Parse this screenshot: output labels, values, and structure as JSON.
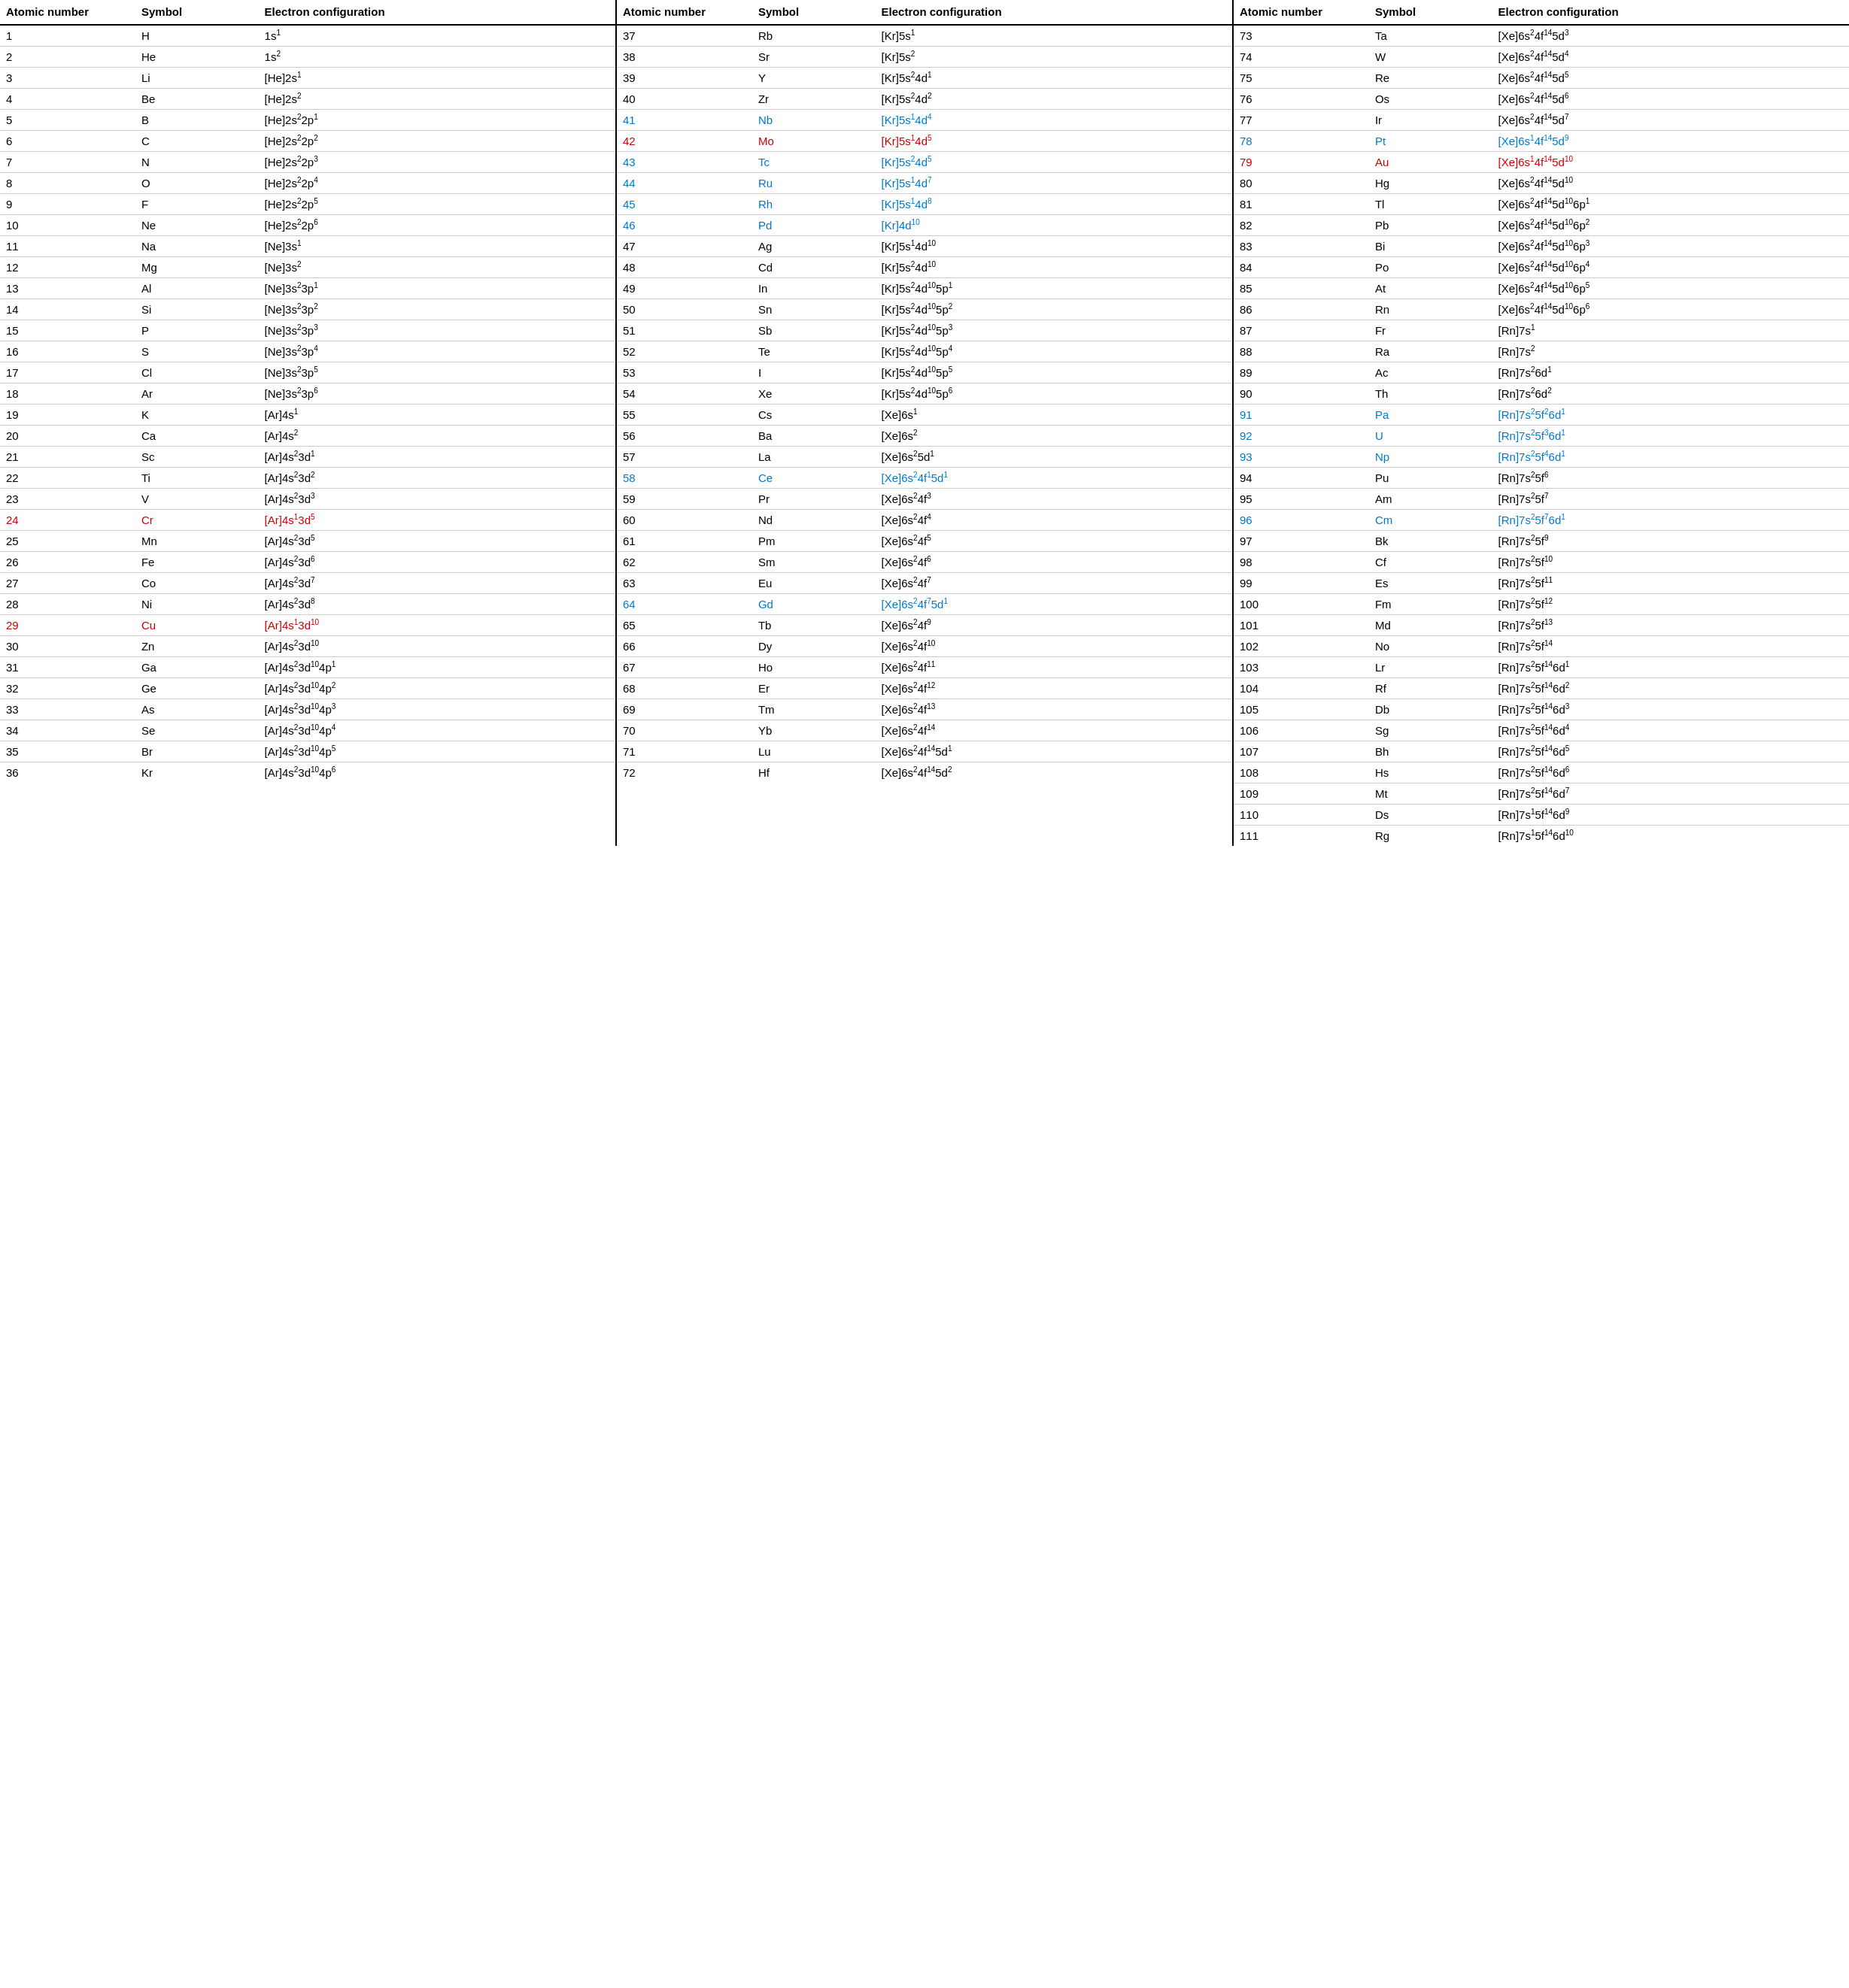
{
  "headers": {
    "atomic_number": "Atomic number",
    "symbol": "Symbol",
    "electron_config": "Electron configuration"
  },
  "sections": [
    {
      "id": "section1",
      "rows": [
        {
          "num": "1",
          "sym": "H",
          "conf": "1s<sup>1</sup>",
          "color": ""
        },
        {
          "num": "2",
          "sym": "He",
          "conf": "1s<sup>2</sup>",
          "color": ""
        },
        {
          "num": "3",
          "sym": "Li",
          "conf": "[He]2s<sup>1</sup>",
          "color": ""
        },
        {
          "num": "4",
          "sym": "Be",
          "conf": "[He]2s<sup>2</sup>",
          "color": ""
        },
        {
          "num": "5",
          "sym": "B",
          "conf": "[He]2s<sup>2</sup>2p<sup>1</sup>",
          "color": ""
        },
        {
          "num": "6",
          "sym": "C",
          "conf": "[He]2s<sup>2</sup>2p<sup>2</sup>",
          "color": ""
        },
        {
          "num": "7",
          "sym": "N",
          "conf": "[He]2s<sup>2</sup>2p<sup>3</sup>",
          "color": ""
        },
        {
          "num": "8",
          "sym": "O",
          "conf": "[He]2s<sup>2</sup>2p<sup>4</sup>",
          "color": ""
        },
        {
          "num": "9",
          "sym": "F",
          "conf": "[He]2s<sup>2</sup>2p<sup>5</sup>",
          "color": ""
        },
        {
          "num": "10",
          "sym": "Ne",
          "conf": "[He]2s<sup>2</sup>2p<sup>6</sup>",
          "color": ""
        },
        {
          "num": "11",
          "sym": "Na",
          "conf": "[Ne]3s<sup>1</sup>",
          "color": ""
        },
        {
          "num": "12",
          "sym": "Mg",
          "conf": "[Ne]3s<sup>2</sup>",
          "color": ""
        },
        {
          "num": "13",
          "sym": "Al",
          "conf": "[Ne]3s<sup>2</sup>3p<sup>1</sup>",
          "color": ""
        },
        {
          "num": "14",
          "sym": "Si",
          "conf": "[Ne]3s<sup>2</sup>3p<sup>2</sup>",
          "color": ""
        },
        {
          "num": "15",
          "sym": "P",
          "conf": "[Ne]3s<sup>2</sup>3p<sup>3</sup>",
          "color": ""
        },
        {
          "num": "16",
          "sym": "S",
          "conf": "[Ne]3s<sup>2</sup>3p<sup>4</sup>",
          "color": ""
        },
        {
          "num": "17",
          "sym": "Cl",
          "conf": "[Ne]3s<sup>2</sup>3p<sup>5</sup>",
          "color": ""
        },
        {
          "num": "18",
          "sym": "Ar",
          "conf": "[Ne]3s<sup>2</sup>3p<sup>6</sup>",
          "color": ""
        },
        {
          "num": "19",
          "sym": "K",
          "conf": "[Ar]4s<sup>1</sup>",
          "color": ""
        },
        {
          "num": "20",
          "sym": "Ca",
          "conf": "[Ar]4s<sup>2</sup>",
          "color": ""
        },
        {
          "num": "21",
          "sym": "Sc",
          "conf": "[Ar]4s<sup>2</sup>3d<sup>1</sup>",
          "color": ""
        },
        {
          "num": "22",
          "sym": "Ti",
          "conf": "[Ar]4s<sup>2</sup>3d<sup>2</sup>",
          "color": ""
        },
        {
          "num": "23",
          "sym": "V",
          "conf": "[Ar]4s<sup>2</sup>3d<sup>3</sup>",
          "color": ""
        },
        {
          "num": "24",
          "sym": "Cr",
          "conf": "[Ar]4s<sup>1</sup>3d<sup>5</sup>",
          "color": "red"
        },
        {
          "num": "25",
          "sym": "Mn",
          "conf": "[Ar]4s<sup>2</sup>3d<sup>5</sup>",
          "color": ""
        },
        {
          "num": "26",
          "sym": "Fe",
          "conf": "[Ar]4s<sup>2</sup>3d<sup>6</sup>",
          "color": ""
        },
        {
          "num": "27",
          "sym": "Co",
          "conf": "[Ar]4s<sup>2</sup>3d<sup>7</sup>",
          "color": ""
        },
        {
          "num": "28",
          "sym": "Ni",
          "conf": "[Ar]4s<sup>2</sup>3d<sup>8</sup>",
          "color": ""
        },
        {
          "num": "29",
          "sym": "Cu",
          "conf": "[Ar]4s<sup>1</sup>3d<sup>10</sup>",
          "color": "red"
        },
        {
          "num": "30",
          "sym": "Zn",
          "conf": "[Ar]4s<sup>2</sup>3d<sup>10</sup>",
          "color": ""
        },
        {
          "num": "31",
          "sym": "Ga",
          "conf": "[Ar]4s<sup>2</sup>3d<sup>10</sup>4p<sup>1</sup>",
          "color": ""
        },
        {
          "num": "32",
          "sym": "Ge",
          "conf": "[Ar]4s<sup>2</sup>3d<sup>10</sup>4p<sup>2</sup>",
          "color": ""
        },
        {
          "num": "33",
          "sym": "As",
          "conf": "[Ar]4s<sup>2</sup>3d<sup>10</sup>4p<sup>3</sup>",
          "color": ""
        },
        {
          "num": "34",
          "sym": "Se",
          "conf": "[Ar]4s<sup>2</sup>3d<sup>10</sup>4p<sup>4</sup>",
          "color": ""
        },
        {
          "num": "35",
          "sym": "Br",
          "conf": "[Ar]4s<sup>2</sup>3d<sup>10</sup>4p<sup>5</sup>",
          "color": ""
        },
        {
          "num": "36",
          "sym": "Kr",
          "conf": "[Ar]4s<sup>2</sup>3d<sup>10</sup>4p<sup>6</sup>",
          "color": ""
        }
      ]
    },
    {
      "id": "section2",
      "rows": [
        {
          "num": "37",
          "sym": "Rb",
          "conf": "[Kr]5s<sup>1</sup>",
          "color": ""
        },
        {
          "num": "38",
          "sym": "Sr",
          "conf": "[Kr]5s<sup>2</sup>",
          "color": ""
        },
        {
          "num": "39",
          "sym": "Y",
          "conf": "[Kr]5s<sup>2</sup>4d<sup>1</sup>",
          "color": ""
        },
        {
          "num": "40",
          "sym": "Zr",
          "conf": "[Kr]5s<sup>2</sup>4d<sup>2</sup>",
          "color": ""
        },
        {
          "num": "41",
          "sym": "Nb",
          "conf": "[Kr]5s<sup>1</sup>4d<sup>4</sup>",
          "color": "blue"
        },
        {
          "num": "42",
          "sym": "Mo",
          "conf": "[Kr]5s<sup>1</sup>4d<sup>5</sup>",
          "color": "red"
        },
        {
          "num": "43",
          "sym": "Tc",
          "conf": "[Kr]5s<sup>2</sup>4d<sup>5</sup>",
          "color": "blue"
        },
        {
          "num": "44",
          "sym": "Ru",
          "conf": "[Kr]5s<sup>1</sup>4d<sup>7</sup>",
          "color": "blue"
        },
        {
          "num": "45",
          "sym": "Rh",
          "conf": "[Kr]5s<sup>1</sup>4d<sup>8</sup>",
          "color": "blue"
        },
        {
          "num": "46",
          "sym": "Pd",
          "conf": "[Kr]4d<sup>10</sup>",
          "color": "blue"
        },
        {
          "num": "47",
          "sym": "Ag",
          "conf": "[Kr]5s<sup>1</sup>4d<sup>10</sup>",
          "color": ""
        },
        {
          "num": "48",
          "sym": "Cd",
          "conf": "[Kr]5s<sup>2</sup>4d<sup>10</sup>",
          "color": ""
        },
        {
          "num": "49",
          "sym": "In",
          "conf": "[Kr]5s<sup>2</sup>4d<sup>10</sup>5p<sup>1</sup>",
          "color": ""
        },
        {
          "num": "50",
          "sym": "Sn",
          "conf": "[Kr]5s<sup>2</sup>4d<sup>10</sup>5p<sup>2</sup>",
          "color": ""
        },
        {
          "num": "51",
          "sym": "Sb",
          "conf": "[Kr]5s<sup>2</sup>4d<sup>10</sup>5p<sup>3</sup>",
          "color": ""
        },
        {
          "num": "52",
          "sym": "Te",
          "conf": "[Kr]5s<sup>2</sup>4d<sup>10</sup>5p<sup>4</sup>",
          "color": ""
        },
        {
          "num": "53",
          "sym": "I",
          "conf": "[Kr]5s<sup>2</sup>4d<sup>10</sup>5p<sup>5</sup>",
          "color": ""
        },
        {
          "num": "54",
          "sym": "Xe",
          "conf": "[Kr]5s<sup>2</sup>4d<sup>10</sup>5p<sup>6</sup>",
          "color": ""
        },
        {
          "num": "55",
          "sym": "Cs",
          "conf": "[Xe]6s<sup>1</sup>",
          "color": ""
        },
        {
          "num": "56",
          "sym": "Ba",
          "conf": "[Xe]6s<sup>2</sup>",
          "color": ""
        },
        {
          "num": "57",
          "sym": "La",
          "conf": "[Xe]6s<sup>2</sup>5d<sup>1</sup>",
          "color": ""
        },
        {
          "num": "58",
          "sym": "Ce",
          "conf": "[Xe]6s<sup>2</sup>4f<sup>1</sup>5d<sup>1</sup>",
          "color": "blue"
        },
        {
          "num": "59",
          "sym": "Pr",
          "conf": "[Xe]6s<sup>2</sup>4f<sup>3</sup>",
          "color": ""
        },
        {
          "num": "60",
          "sym": "Nd",
          "conf": "[Xe]6s<sup>2</sup>4f<sup>4</sup>",
          "color": ""
        },
        {
          "num": "61",
          "sym": "Pm",
          "conf": "[Xe]6s<sup>2</sup>4f<sup>5</sup>",
          "color": ""
        },
        {
          "num": "62",
          "sym": "Sm",
          "conf": "[Xe]6s<sup>2</sup>4f<sup>6</sup>",
          "color": ""
        },
        {
          "num": "63",
          "sym": "Eu",
          "conf": "[Xe]6s<sup>2</sup>4f<sup>7</sup>",
          "color": ""
        },
        {
          "num": "64",
          "sym": "Gd",
          "conf": "[Xe]6s<sup>2</sup>4f<sup>7</sup>5d<sup>1</sup>",
          "color": "blue"
        },
        {
          "num": "65",
          "sym": "Tb",
          "conf": "[Xe]6s<sup>2</sup>4f<sup>9</sup>",
          "color": ""
        },
        {
          "num": "66",
          "sym": "Dy",
          "conf": "[Xe]6s<sup>2</sup>4f<sup>10</sup>",
          "color": ""
        },
        {
          "num": "67",
          "sym": "Ho",
          "conf": "[Xe]6s<sup>2</sup>4f<sup>11</sup>",
          "color": ""
        },
        {
          "num": "68",
          "sym": "Er",
          "conf": "[Xe]6s<sup>2</sup>4f<sup>12</sup>",
          "color": ""
        },
        {
          "num": "69",
          "sym": "Tm",
          "conf": "[Xe]6s<sup>2</sup>4f<sup>13</sup>",
          "color": ""
        },
        {
          "num": "70",
          "sym": "Yb",
          "conf": "[Xe]6s<sup>2</sup>4f<sup>14</sup>",
          "color": ""
        },
        {
          "num": "71",
          "sym": "Lu",
          "conf": "[Xe]6s<sup>2</sup>4f<sup>14</sup>5d<sup>1</sup>",
          "color": ""
        },
        {
          "num": "72",
          "sym": "Hf",
          "conf": "[Xe]6s<sup>2</sup>4f<sup>14</sup>5d<sup>2</sup>",
          "color": ""
        }
      ]
    },
    {
      "id": "section3",
      "rows": [
        {
          "num": "73",
          "sym": "Ta",
          "conf": "[Xe]6s<sup>2</sup>4f<sup>14</sup>5d<sup>3</sup>",
          "color": ""
        },
        {
          "num": "74",
          "sym": "W",
          "conf": "[Xe]6s<sup>2</sup>4f<sup>14</sup>5d<sup>4</sup>",
          "color": ""
        },
        {
          "num": "75",
          "sym": "Re",
          "conf": "[Xe]6s<sup>2</sup>4f<sup>14</sup>5d<sup>5</sup>",
          "color": ""
        },
        {
          "num": "76",
          "sym": "Os",
          "conf": "[Xe]6s<sup>2</sup>4f<sup>14</sup>5d<sup>6</sup>",
          "color": ""
        },
        {
          "num": "77",
          "sym": "Ir",
          "conf": "[Xe]6s<sup>2</sup>4f<sup>14</sup>5d<sup>7</sup>",
          "color": ""
        },
        {
          "num": "78",
          "sym": "Pt",
          "conf": "[Xe]6s<sup>1</sup>4f<sup>14</sup>5d<sup>9</sup>",
          "color": "blue"
        },
        {
          "num": "79",
          "sym": "Au",
          "conf": "[Xe]6s<sup>1</sup>4f<sup>14</sup>5d<sup>10</sup>",
          "color": "red"
        },
        {
          "num": "80",
          "sym": "Hg",
          "conf": "[Xe]6s<sup>2</sup>4f<sup>14</sup>5d<sup>10</sup>",
          "color": ""
        },
        {
          "num": "81",
          "sym": "Tl",
          "conf": "[Xe]6s<sup>2</sup>4f<sup>14</sup>5d<sup>10</sup>6p<sup>1</sup>",
          "color": ""
        },
        {
          "num": "82",
          "sym": "Pb",
          "conf": "[Xe]6s<sup>2</sup>4f<sup>14</sup>5d<sup>10</sup>6p<sup>2</sup>",
          "color": ""
        },
        {
          "num": "83",
          "sym": "Bi",
          "conf": "[Xe]6s<sup>2</sup>4f<sup>14</sup>5d<sup>10</sup>6p<sup>3</sup>",
          "color": ""
        },
        {
          "num": "84",
          "sym": "Po",
          "conf": "[Xe]6s<sup>2</sup>4f<sup>14</sup>5d<sup>10</sup>6p<sup>4</sup>",
          "color": ""
        },
        {
          "num": "85",
          "sym": "At",
          "conf": "[Xe]6s<sup>2</sup>4f<sup>14</sup>5d<sup>10</sup>6p<sup>5</sup>",
          "color": ""
        },
        {
          "num": "86",
          "sym": "Rn",
          "conf": "[Xe]6s<sup>2</sup>4f<sup>14</sup>5d<sup>10</sup>6p<sup>6</sup>",
          "color": ""
        },
        {
          "num": "87",
          "sym": "Fr",
          "conf": "[Rn]7s<sup>1</sup>",
          "color": ""
        },
        {
          "num": "88",
          "sym": "Ra",
          "conf": "[Rn]7s<sup>2</sup>",
          "color": ""
        },
        {
          "num": "89",
          "sym": "Ac",
          "conf": "[Rn]7s<sup>2</sup>6d<sup>1</sup>",
          "color": ""
        },
        {
          "num": "90",
          "sym": "Th",
          "conf": "[Rn]7s<sup>2</sup>6d<sup>2</sup>",
          "color": ""
        },
        {
          "num": "91",
          "sym": "Pa",
          "conf": "[Rn]7s<sup>2</sup>5f<sup>2</sup>6d<sup>1</sup>",
          "color": "blue"
        },
        {
          "num": "92",
          "sym": "U",
          "conf": "[Rn]7s<sup>2</sup>5f<sup>3</sup>6d<sup>1</sup>",
          "color": "blue"
        },
        {
          "num": "93",
          "sym": "Np",
          "conf": "[Rn]7s<sup>2</sup>5f<sup>4</sup>6d<sup>1</sup>",
          "color": "blue"
        },
        {
          "num": "94",
          "sym": "Pu",
          "conf": "[Rn]7s<sup>2</sup>5f<sup>6</sup>",
          "color": ""
        },
        {
          "num": "95",
          "sym": "Am",
          "conf": "[Rn]7s<sup>2</sup>5f<sup>7</sup>",
          "color": ""
        },
        {
          "num": "96",
          "sym": "Cm",
          "conf": "[Rn]7s<sup>2</sup>5f<sup>7</sup>6d<sup>1</sup>",
          "color": "blue"
        },
        {
          "num": "97",
          "sym": "Bk",
          "conf": "[Rn]7s<sup>2</sup>5f<sup>9</sup>",
          "color": ""
        },
        {
          "num": "98",
          "sym": "Cf",
          "conf": "[Rn]7s<sup>2</sup>5f<sup>10</sup>",
          "color": ""
        },
        {
          "num": "99",
          "sym": "Es",
          "conf": "[Rn]7s<sup>2</sup>5f<sup>11</sup>",
          "color": ""
        },
        {
          "num": "100",
          "sym": "Fm",
          "conf": "[Rn]7s<sup>2</sup>5f<sup>12</sup>",
          "color": ""
        },
        {
          "num": "101",
          "sym": "Md",
          "conf": "[Rn]7s<sup>2</sup>5f<sup>13</sup>",
          "color": ""
        },
        {
          "num": "102",
          "sym": "No",
          "conf": "[Rn]7s<sup>2</sup>5f<sup>14</sup>",
          "color": ""
        },
        {
          "num": "103",
          "sym": "Lr",
          "conf": "[Rn]7s<sup>2</sup>5f<sup>14</sup>6d<sup>1</sup>",
          "color": ""
        },
        {
          "num": "104",
          "sym": "Rf",
          "conf": "[Rn]7s<sup>2</sup>5f<sup>14</sup>6d<sup>2</sup>",
          "color": ""
        },
        {
          "num": "105",
          "sym": "Db",
          "conf": "[Rn]7s<sup>2</sup>5f<sup>14</sup>6d<sup>3</sup>",
          "color": ""
        },
        {
          "num": "106",
          "sym": "Sg",
          "conf": "[Rn]7s<sup>2</sup>5f<sup>14</sup>6d<sup>4</sup>",
          "color": ""
        },
        {
          "num": "107",
          "sym": "Bh",
          "conf": "[Rn]7s<sup>2</sup>5f<sup>14</sup>6d<sup>5</sup>",
          "color": ""
        },
        {
          "num": "108",
          "sym": "Hs",
          "conf": "[Rn]7s<sup>2</sup>5f<sup>14</sup>6d<sup>6</sup>",
          "color": ""
        },
        {
          "num": "109",
          "sym": "Mt",
          "conf": "[Rn]7s<sup>2</sup>5f<sup>14</sup>6d<sup>7</sup>",
          "color": ""
        },
        {
          "num": "110",
          "sym": "Ds",
          "conf": "[Rn]7s<sup>1</sup>5f<sup>14</sup>6d<sup>9</sup>",
          "color": ""
        },
        {
          "num": "111",
          "sym": "Rg",
          "conf": "[Rn]7s<sup>1</sup>5f<sup>14</sup>6d<sup>10</sup>",
          "color": ""
        }
      ]
    }
  ]
}
